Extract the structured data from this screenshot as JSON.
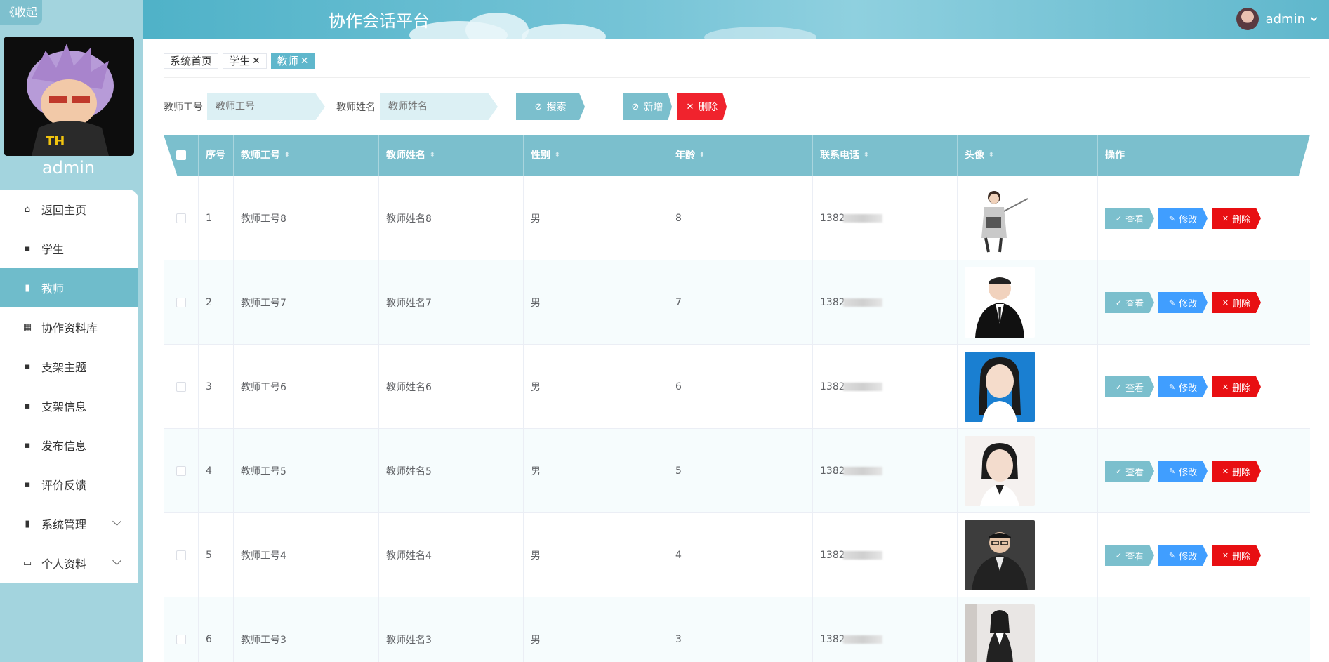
{
  "sidebar": {
    "collapse_label": "《收起",
    "user_name": "admin",
    "menu": [
      {
        "label": "返回主页",
        "icon": "home-icon",
        "active": false,
        "expandable": false
      },
      {
        "label": "学生",
        "icon": "chat-icon",
        "active": false,
        "expandable": false
      },
      {
        "label": "教师",
        "icon": "clipboard-icon",
        "active": true,
        "expandable": false
      },
      {
        "label": "协作资料库",
        "icon": "grid9-icon",
        "active": false,
        "expandable": false
      },
      {
        "label": "支架主题",
        "icon": "grid4-icon",
        "active": false,
        "expandable": false
      },
      {
        "label": "支架信息",
        "icon": "grid4-icon",
        "active": false,
        "expandable": false
      },
      {
        "label": "发布信息",
        "icon": "grid4-icon",
        "active": false,
        "expandable": false
      },
      {
        "label": "评价反馈",
        "icon": "grid4-icon",
        "active": false,
        "expandable": false
      },
      {
        "label": "系统管理",
        "icon": "clipboard-icon",
        "active": false,
        "expandable": true
      },
      {
        "label": "个人资料",
        "icon": "card-icon",
        "active": false,
        "expandable": true
      }
    ]
  },
  "header": {
    "title": "协作会话平台",
    "user": "admin"
  },
  "tags": [
    {
      "label": "系统首页",
      "closable": false,
      "active": false
    },
    {
      "label": "学生",
      "closable": true,
      "active": false
    },
    {
      "label": "教师",
      "closable": true,
      "active": true
    }
  ],
  "search": {
    "id_label": "教师工号",
    "id_placeholder": "教师工号",
    "name_label": "教师姓名",
    "name_placeholder": "教师姓名",
    "search_btn": "搜索",
    "add_btn": "新增",
    "delete_btn": "删除"
  },
  "table": {
    "columns": [
      "序号",
      "教师工号",
      "教师姓名",
      "性别",
      "年龄",
      "联系电话",
      "头像",
      "操作"
    ],
    "actions": {
      "view": "查看",
      "edit": "修改",
      "delete": "删除"
    },
    "rows": [
      {
        "index": "1",
        "teacher_id": "教师工号8",
        "teacher_name": "教师姓名8",
        "gender": "男",
        "age": "8",
        "phone": "1382",
        "photo": "teacher-presenting",
        "has_actions": true
      },
      {
        "index": "2",
        "teacher_id": "教师工号7",
        "teacher_name": "教师姓名7",
        "gender": "男",
        "age": "7",
        "phone": "1382",
        "photo": "man-suit",
        "has_actions": true
      },
      {
        "index": "3",
        "teacher_id": "教师工号6",
        "teacher_name": "教师姓名6",
        "gender": "男",
        "age": "6",
        "phone": "1382",
        "photo": "woman-blue-bg",
        "has_actions": true
      },
      {
        "index": "4",
        "teacher_id": "教师工号5",
        "teacher_name": "教师姓名5",
        "gender": "男",
        "age": "5",
        "phone": "1382",
        "photo": "woman-white-bg",
        "has_actions": true
      },
      {
        "index": "5",
        "teacher_id": "教师工号4",
        "teacher_name": "教师姓名4",
        "gender": "男",
        "age": "4",
        "phone": "1382",
        "photo": "man-glasses",
        "has_actions": true
      },
      {
        "index": "6",
        "teacher_id": "教师工号3",
        "teacher_name": "教师姓名3",
        "gender": "男",
        "age": "3",
        "phone": "1382",
        "photo": "woman-standing",
        "has_actions": false
      }
    ]
  },
  "colors": {
    "accent": "#7bbfcd",
    "sidebar_bg": "#a3d4de",
    "active_menu": "#6fbccb",
    "edit_btn": "#409eff",
    "delete_btn": "#e80f12"
  }
}
